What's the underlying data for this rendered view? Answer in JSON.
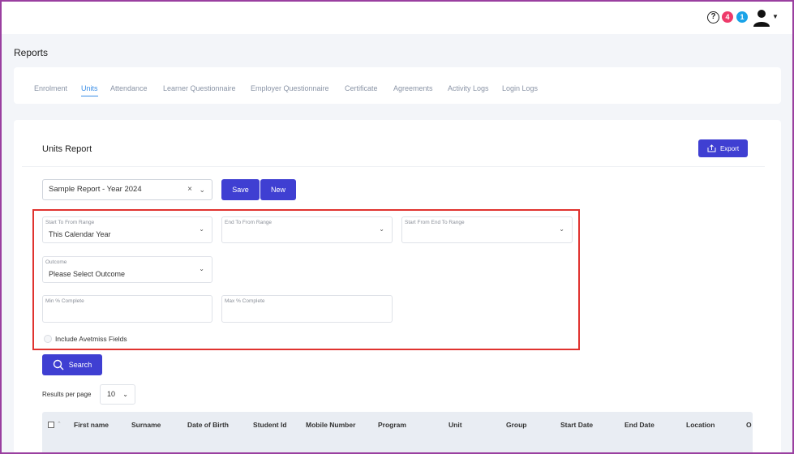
{
  "topbar": {
    "help_icon": "help-circle-icon",
    "notification_count_red": "4",
    "notification_count_blue": "1",
    "user_icon": "user-icon"
  },
  "page": {
    "title": "Reports"
  },
  "tabs": [
    {
      "label": "Enrolment",
      "active": false
    },
    {
      "label": "Units",
      "active": true
    },
    {
      "label": "Attendance",
      "active": false
    },
    {
      "label": "Learner Questionnaire",
      "active": false
    },
    {
      "label": "Employer Questionnaire",
      "active": false
    },
    {
      "label": "Certificate",
      "active": false
    },
    {
      "label": "Agreements",
      "active": false
    },
    {
      "label": "Activity Logs",
      "active": false
    },
    {
      "label": "Login Logs",
      "active": false
    }
  ],
  "report": {
    "title": "Units Report",
    "export_label": "Export",
    "selected_report": "Sample Report - Year 2024",
    "clear_glyph": "×",
    "save_label": "Save",
    "new_label": "New"
  },
  "filters": {
    "start_to_from_range": {
      "label": "Start To From Range",
      "value": "This Calendar Year"
    },
    "end_to_from_range": {
      "label": "End To From Range",
      "value": ""
    },
    "start_from_end_to_range": {
      "label": "Start From End To Range",
      "value": ""
    },
    "outcome": {
      "label": "Outcome",
      "value": "Please Select Outcome"
    },
    "min_complete": {
      "label": "Min % Complete",
      "value": ""
    },
    "max_complete": {
      "label": "Max % Complete",
      "value": ""
    },
    "include_avetmiss": {
      "label": "Include Avetmiss Fields",
      "checked": false
    }
  },
  "search": {
    "label": "Search"
  },
  "pagination": {
    "label": "Results per page",
    "value": "10"
  },
  "table": {
    "columns": [
      "First name",
      "Surname",
      "Date of Birth",
      "Student Id",
      "Mobile Number",
      "Program",
      "Unit",
      "Group",
      "Start Date",
      "End Date",
      "Location",
      "O"
    ]
  },
  "colors": {
    "accent": "#3f3fd2",
    "highlight": "#e0332f",
    "active_tab": "#3a8ee6"
  }
}
